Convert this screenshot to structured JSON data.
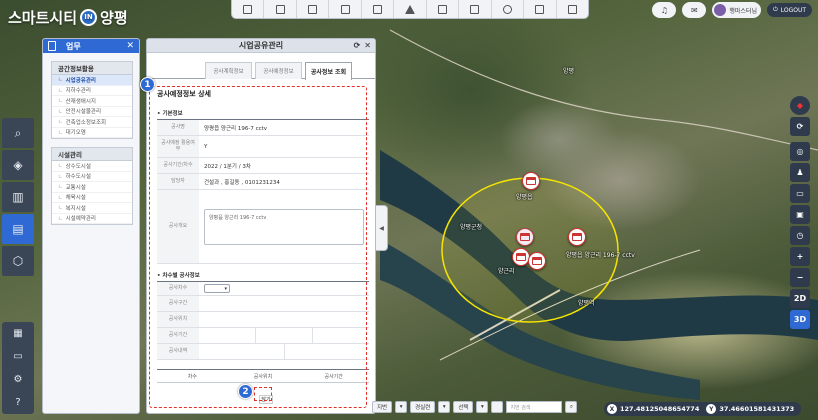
{
  "app": {
    "logo_left": "스마트시티",
    "logo_in": "IN",
    "logo_right": "양평"
  },
  "topbar": {
    "icons": [
      "copy-icon",
      "document-icon",
      "export-icon",
      "layers-icon",
      "image-icon",
      "star-icon",
      "download-icon",
      "print-icon",
      "edit-icon",
      "book-icon",
      "settings-icon"
    ]
  },
  "header_right": {
    "user_name": "행마스터님",
    "logout_label": "LOGOUT"
  },
  "rail": {
    "items": [
      {
        "icon": "search-icon",
        "glyph": "⌕"
      },
      {
        "icon": "layers-icon",
        "glyph": "◈"
      },
      {
        "icon": "map-icon",
        "glyph": "▥"
      },
      {
        "icon": "document-icon",
        "glyph": "▤"
      },
      {
        "icon": "cube-icon",
        "glyph": "⬡"
      }
    ],
    "bottom_items": [
      {
        "icon": "notes-icon",
        "glyph": "▦"
      },
      {
        "icon": "monitor-icon",
        "glyph": "▭"
      },
      {
        "icon": "gear-icon",
        "glyph": "⚙"
      },
      {
        "icon": "help-icon",
        "glyph": "?"
      }
    ]
  },
  "work_panel": {
    "title": "업무",
    "groups": [
      {
        "title": "공간정보활용",
        "items": [
          "시업공유관리",
          "지하수관리",
          "산재생애시지",
          "안전시설물관리",
          "건축업소정보조회",
          "대기오염"
        ]
      },
      {
        "title": "시설관리",
        "items": [
          "상수도시설",
          "하수도시설",
          "교통시설",
          "체육시설",
          "복지시설",
          "시설예약관리"
        ]
      }
    ]
  },
  "main_panel": {
    "title": "시업공유관리",
    "tabs": [
      "공사계획정보",
      "공사예정정보",
      "공사정보 조회"
    ],
    "detail_title": "공사예정정보 상세",
    "basic_section": "기본정보",
    "basic_fields": [
      {
        "label": "공사명",
        "value": "양평읍 양근리 196-7 cctv"
      },
      {
        "label": "공사예정 활용여부",
        "value": "Y"
      },
      {
        "label": "공사기간/차수",
        "value": "2022 / 1분기 / 3차"
      },
      {
        "label": "담당자",
        "value": "건설과 , 홍길동 , 0101231234"
      }
    ],
    "summary_label": "공사개요",
    "summary_value": "양평읍 양근리 196-7 cctv",
    "stage_section": "차수별 공사정보",
    "stage_fields": [
      "공사차수",
      "공사구간",
      "공사위치",
      "공사기간",
      "공사내역"
    ],
    "stage_select_value": "",
    "list_headers": [
      "차수",
      "공사위치",
      "공사기간"
    ],
    "close_label": "닫기"
  },
  "annotations": {
    "badge_1": "1",
    "badge_2": "2"
  },
  "map": {
    "labels": [
      {
        "text": "양평군청"
      },
      {
        "text": "양평읍"
      },
      {
        "text": "양평읍 양근리 196-7 cctv"
      },
      {
        "text": "양근리"
      },
      {
        "text": "양평역"
      },
      {
        "text": "양평"
      }
    ],
    "buffer_color": "#f5e400"
  },
  "right_tools": [
    "compass-icon",
    "refresh-icon",
    "globe-icon",
    "person-icon",
    "ruler-icon",
    "area-icon",
    "clock-icon",
    "zoom-in-icon",
    "zoom-out-icon",
    "2D",
    "3D"
  ],
  "bottom_bar": {
    "btn_1": "지번",
    "btn_2": "경실련",
    "btn_3": "선택",
    "search_placeholder": "지번 검색"
  },
  "coords": {
    "x_label": "X",
    "x_value": "127.48125048654774",
    "y_label": "Y",
    "y_value": "37.46601581431373"
  }
}
